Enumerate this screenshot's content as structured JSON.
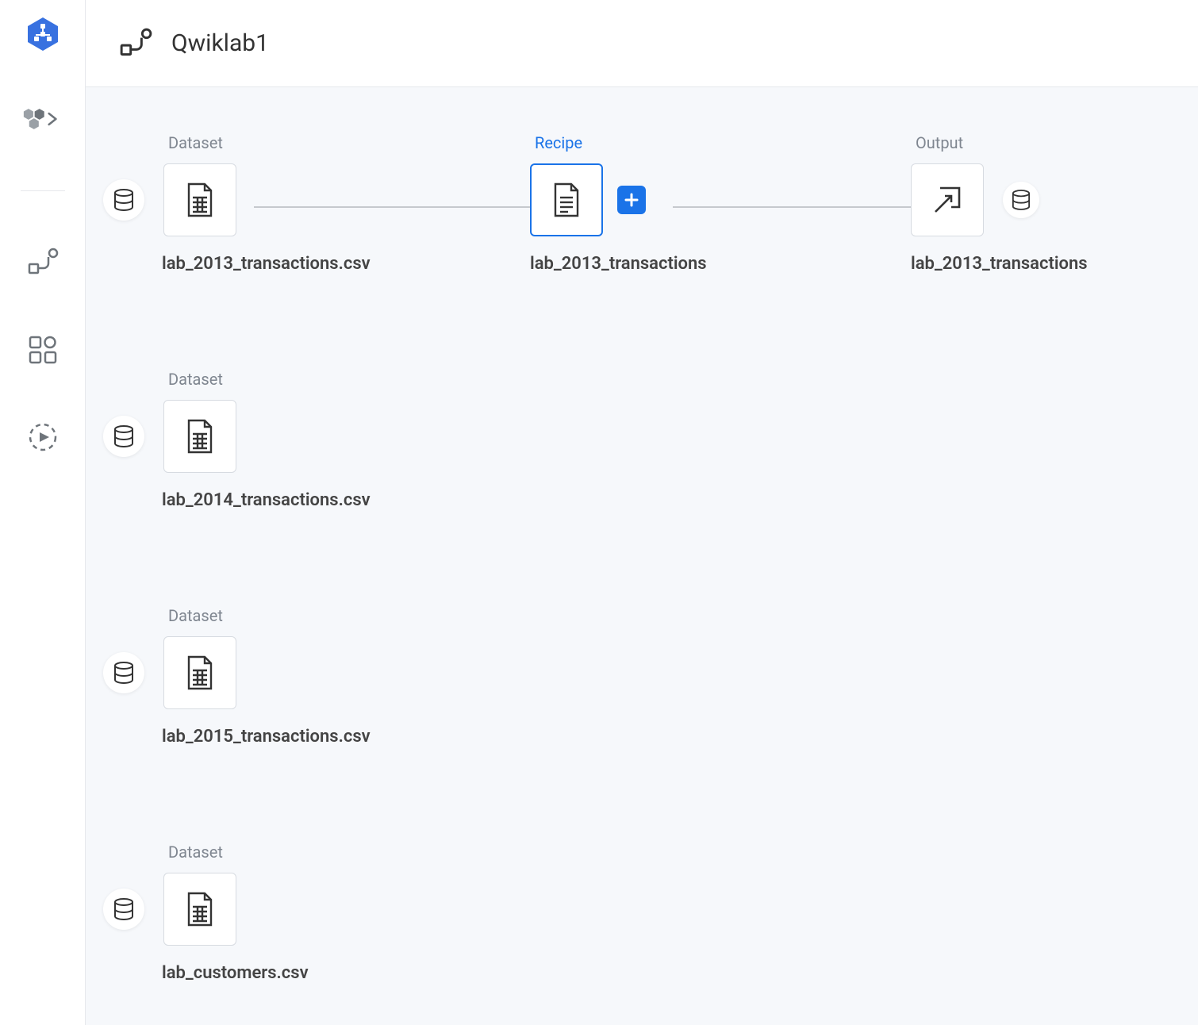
{
  "header": {
    "title": "Qwiklab1"
  },
  "nodes": {
    "dataset1": {
      "label": "Dataset",
      "name": "lab_2013_transactions.csv"
    },
    "dataset2": {
      "label": "Dataset",
      "name": "lab_2014_transactions.csv"
    },
    "dataset3": {
      "label": "Dataset",
      "name": "lab_2015_transactions.csv"
    },
    "dataset4": {
      "label": "Dataset",
      "name": "lab_customers.csv"
    },
    "recipe": {
      "label": "Recipe",
      "name": "lab_2013_transactions"
    },
    "output": {
      "label": "Output",
      "name": "lab_2013_transactions"
    }
  }
}
